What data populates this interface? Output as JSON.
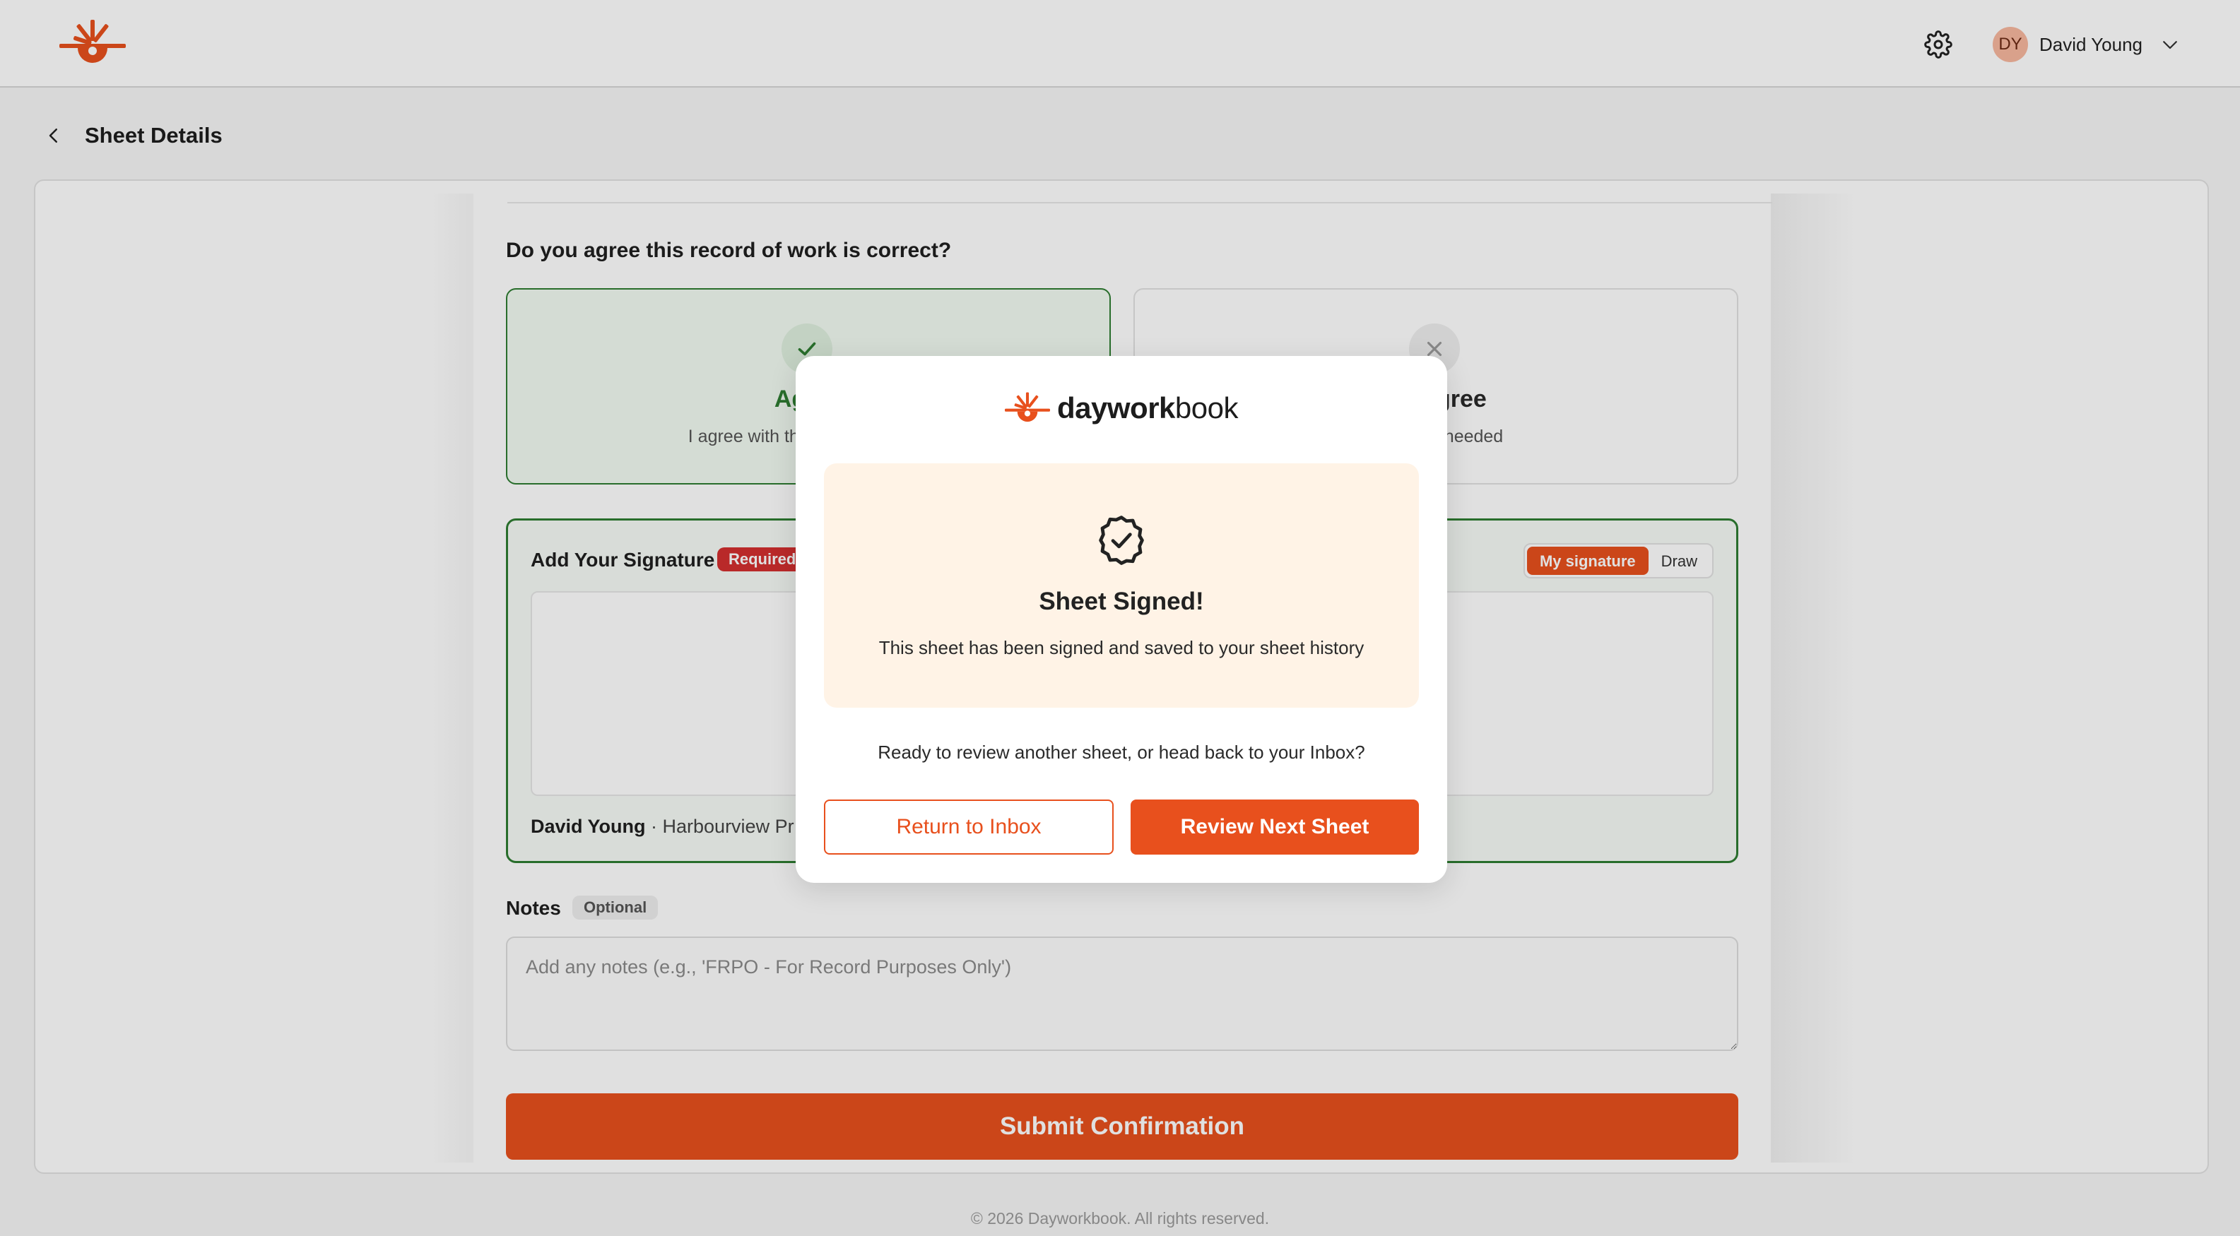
{
  "colors": {
    "brand_orange": "#e8501d",
    "agree_green": "#2e7d32",
    "required_red": "#d32f2f",
    "success_bg": "#fff3e6"
  },
  "header": {
    "logo_icon": "dayworkbook-logo-icon",
    "settings_icon": "gear-icon",
    "user": {
      "initials": "DY",
      "name": "David Young",
      "menu_icon": "chevron-down-icon"
    }
  },
  "subheader": {
    "back_icon": "chevron-left-icon",
    "title": "Sheet Details"
  },
  "form": {
    "question": "Do you agree this record of work is correct?",
    "agree": {
      "icon": "check-icon",
      "title": "Agree",
      "description": "I agree with this record of work"
    },
    "disagree": {
      "icon": "close-icon",
      "title": "Disagree",
      "description": "Changes needed"
    },
    "signature": {
      "label": "Add Your Signature",
      "required_badge": "Required",
      "toggle": [
        "My signature",
        "Draw"
      ],
      "selected_toggle": "My signature",
      "owner_name": "David Young",
      "owner_separator": " · ",
      "owner_company": "Harbourview Pr"
    },
    "notes": {
      "label": "Notes",
      "optional_badge": "Optional",
      "placeholder": "Add any notes (e.g., 'FRPO - For Record Purposes Only')",
      "value": ""
    },
    "submit_label": "Submit Confirmation"
  },
  "footer": {
    "copyright": "© 2026 Dayworkbook. All rights reserved."
  },
  "modal": {
    "brand_bold": "daywork",
    "brand_regular": "book",
    "success_icon": "badge-check-icon",
    "success_title": "Sheet Signed!",
    "success_message": "This sheet has been signed and saved to your sheet history",
    "question": "Ready to review another sheet, or head back to your Inbox?",
    "secondary_button": "Return to Inbox",
    "primary_button": "Review Next Sheet"
  }
}
